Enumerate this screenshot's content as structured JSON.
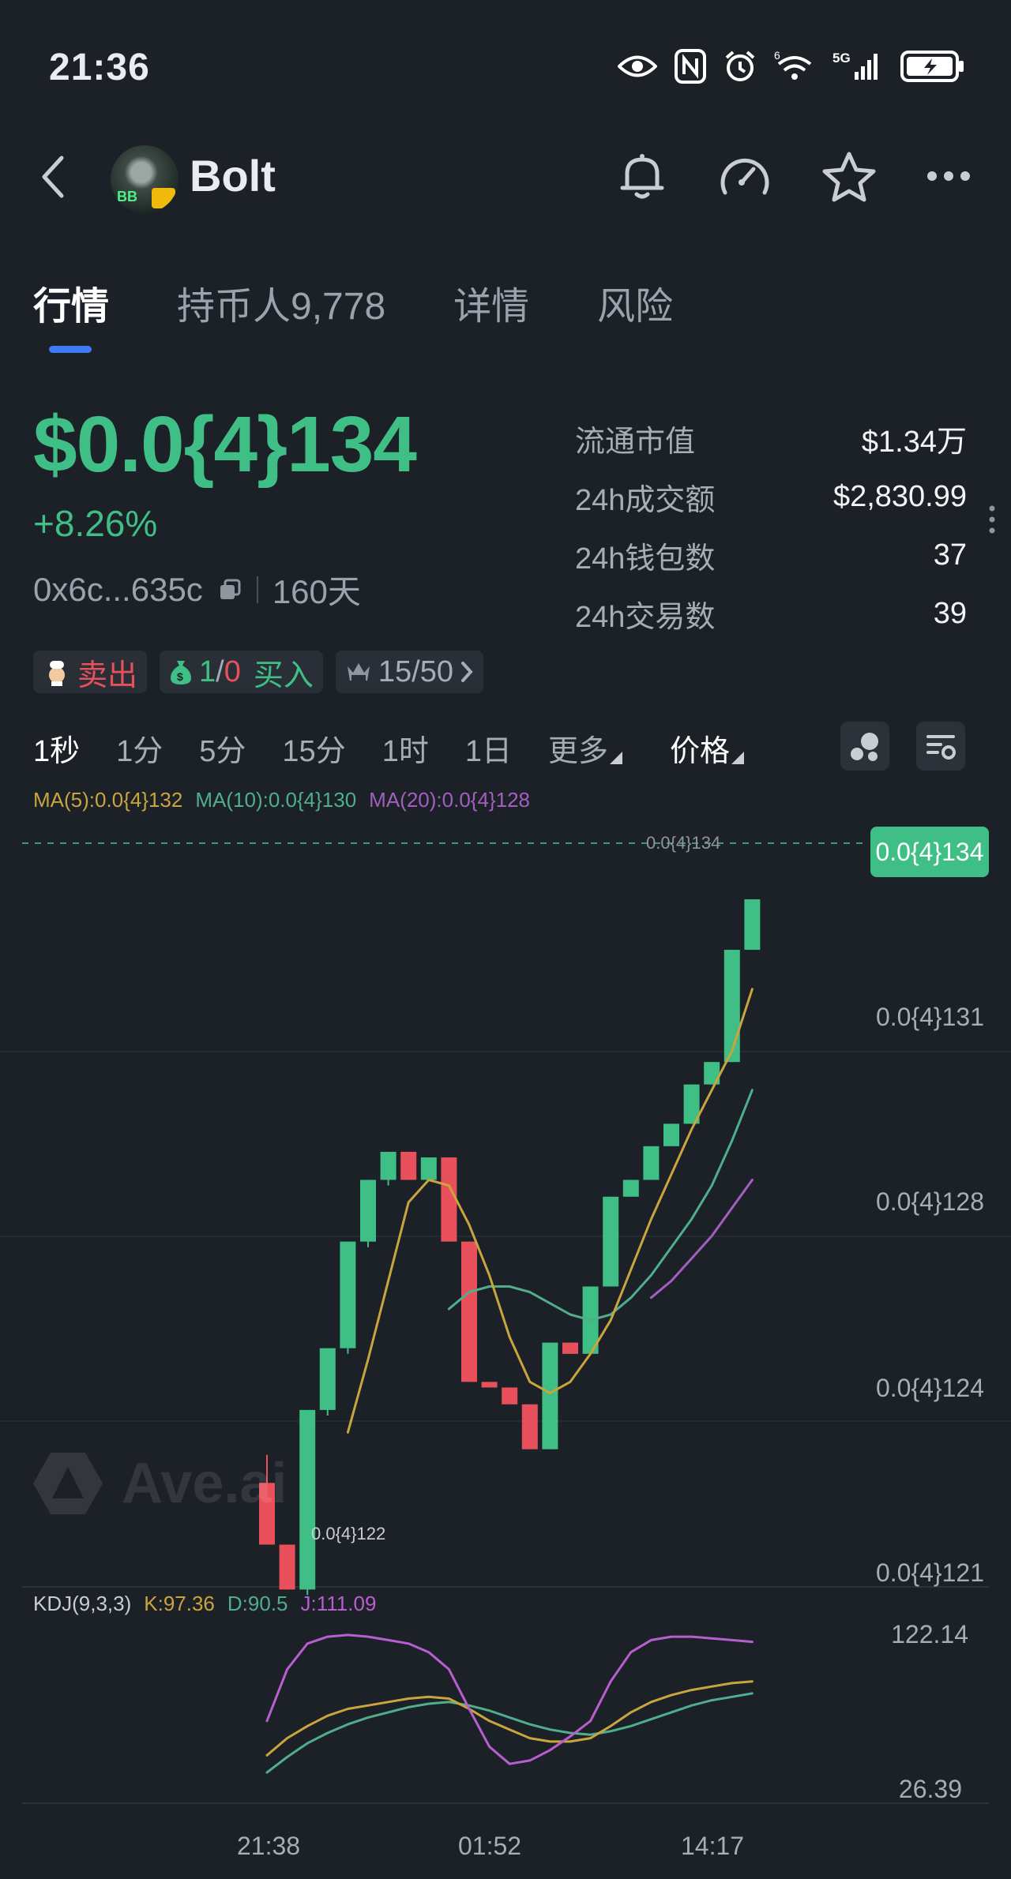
{
  "status_bar": {
    "time": "21:36",
    "network": "5G",
    "signal_sup": "6"
  },
  "header": {
    "token_name": "Bolt",
    "avatar_tag": "BB"
  },
  "tabs": [
    {
      "label": "行情"
    },
    {
      "label": "持币人9,778"
    },
    {
      "label": "详情"
    },
    {
      "label": "风险"
    }
  ],
  "price": {
    "value": "$0.0{4}134",
    "change": "+8.26%",
    "address": "0x6c...635c",
    "age": "160天"
  },
  "stats": [
    {
      "label": "流通市值",
      "value": "$1.34万"
    },
    {
      "label": "24h成交额",
      "value": "$2,830.99"
    },
    {
      "label": "24h钱包数",
      "value": "37"
    },
    {
      "label": "24h交易数",
      "value": "39"
    }
  ],
  "chips": {
    "sell": "卖出",
    "buy_a": "1",
    "buy_sep": "/",
    "buy_b": "0",
    "buy": "买入",
    "top": "15/50"
  },
  "intervals": [
    "1秒",
    "1分",
    "5分",
    "15分",
    "1时",
    "1日",
    "更多"
  ],
  "price_selector": "价格",
  "ma_legend": {
    "ma5": "MA(5):0.0{4}132",
    "ma10": "MA(10):0.0{4}130",
    "ma20": "MA(20):0.0{4}128"
  },
  "kdj_legend": {
    "name": "KDJ(9,3,3)",
    "k": "K:97.36",
    "d": "D:90.5",
    "j": "J:111.09"
  },
  "watermark": "Ave.ai",
  "colors": {
    "up": "#3fbf86",
    "down": "#e8505b",
    "ma5": "#c9a53d",
    "ma10": "#4fae8c",
    "ma20": "#a35fc0",
    "k": "#c9a53d",
    "d": "#4fae8c",
    "j": "#b85fd0"
  },
  "chart_data": {
    "type": "candlestick",
    "price_unit": "0.0{4}",
    "y_axis_labels": [
      "0.0{4}131",
      "0.0{4}128",
      "0.0{4}124",
      "0.0{4}121"
    ],
    "y_axis_values": [
      131,
      128,
      124,
      121
    ],
    "current_price_label": "0.0{4}134",
    "current_price": 134,
    "high_label": "0.0{4}134",
    "low_label": "0.0{4}122",
    "x_labels": [
      "21:38",
      "01:52",
      "14:17"
    ],
    "candles": [
      {
        "o": 122.6,
        "h": 123.1,
        "l": 121.5,
        "c": 121.5
      },
      {
        "o": 121.5,
        "h": 121.5,
        "l": 120.7,
        "c": 120.7
      },
      {
        "o": 120.7,
        "h": 123.9,
        "l": 120.6,
        "c": 123.9
      },
      {
        "o": 123.9,
        "h": 125.0,
        "l": 123.8,
        "c": 125.0
      },
      {
        "o": 125.0,
        "h": 126.9,
        "l": 124.9,
        "c": 126.9
      },
      {
        "o": 126.9,
        "h": 128.0,
        "l": 126.8,
        "c": 128.0
      },
      {
        "o": 128.0,
        "h": 128.5,
        "l": 127.9,
        "c": 128.5
      },
      {
        "o": 128.5,
        "h": 128.5,
        "l": 128.0,
        "c": 128.0
      },
      {
        "o": 128.0,
        "h": 128.4,
        "l": 128.0,
        "c": 128.4
      },
      {
        "o": 128.4,
        "h": 128.4,
        "l": 126.9,
        "c": 126.9
      },
      {
        "o": 126.9,
        "h": 126.9,
        "l": 124.4,
        "c": 124.4
      },
      {
        "o": 124.4,
        "h": 124.4,
        "l": 124.3,
        "c": 124.3
      },
      {
        "o": 124.3,
        "h": 124.3,
        "l": 124.0,
        "c": 124.0
      },
      {
        "o": 124.0,
        "h": 124.0,
        "l": 123.2,
        "c": 123.2
      },
      {
        "o": 123.2,
        "h": 125.1,
        "l": 123.2,
        "c": 125.1
      },
      {
        "o": 125.1,
        "h": 125.1,
        "l": 124.9,
        "c": 124.9
      },
      {
        "o": 124.9,
        "h": 126.1,
        "l": 124.9,
        "c": 126.1
      },
      {
        "o": 126.1,
        "h": 127.7,
        "l": 126.1,
        "c": 127.7
      },
      {
        "o": 127.7,
        "h": 128.0,
        "l": 127.7,
        "c": 128.0
      },
      {
        "o": 128.0,
        "h": 128.6,
        "l": 128.0,
        "c": 128.6
      },
      {
        "o": 128.6,
        "h": 129.0,
        "l": 128.6,
        "c": 129.0
      },
      {
        "o": 129.0,
        "h": 129.7,
        "l": 129.0,
        "c": 129.7
      },
      {
        "o": 129.7,
        "h": 130.1,
        "l": 129.7,
        "c": 130.1
      },
      {
        "o": 130.1,
        "h": 132.1,
        "l": 130.1,
        "c": 132.1
      },
      {
        "o": 132.1,
        "h": 133.0,
        "l": 132.1,
        "c": 133.0
      }
    ],
    "ma5": [
      null,
      null,
      null,
      null,
      123.5,
      124.8,
      126.2,
      127.6,
      128.0,
      127.9,
      127.2,
      126.3,
      125.2,
      124.4,
      124.2,
      124.4,
      124.9,
      125.5,
      126.4,
      127.3,
      128.1,
      128.9,
      129.6,
      130.3,
      131.4
    ],
    "ma10": [
      null,
      null,
      null,
      null,
      null,
      null,
      null,
      null,
      null,
      125.7,
      126.0,
      126.1,
      126.1,
      126.0,
      125.8,
      125.6,
      125.5,
      125.6,
      125.9,
      126.3,
      126.8,
      127.3,
      127.9,
      128.7,
      129.6
    ],
    "ma20": [
      null,
      null,
      null,
      null,
      null,
      null,
      null,
      null,
      null,
      null,
      null,
      null,
      null,
      null,
      null,
      null,
      null,
      null,
      null,
      125.9,
      126.2,
      126.6,
      127.0,
      127.5,
      128.0
    ],
    "kdj_axis_labels": [
      "122.14",
      "26.39"
    ],
    "kdj_k": [
      35,
      45,
      52,
      58,
      62,
      64,
      66,
      68,
      69,
      68,
      62,
      55,
      50,
      45,
      43,
      43,
      45,
      52,
      60,
      66,
      70,
      73,
      75,
      77,
      78
    ],
    "kdj_d": [
      25,
      34,
      42,
      48,
      53,
      57,
      60,
      63,
      65,
      66,
      64,
      61,
      57,
      53,
      50,
      48,
      47,
      49,
      52,
      56,
      60,
      64,
      67,
      69,
      71
    ],
    "kdj_j": [
      55,
      85,
      100,
      104,
      105,
      104,
      102,
      100,
      95,
      85,
      62,
      40,
      30,
      32,
      38,
      46,
      55,
      78,
      95,
      102,
      104,
      104,
      103,
      102,
      101
    ]
  }
}
